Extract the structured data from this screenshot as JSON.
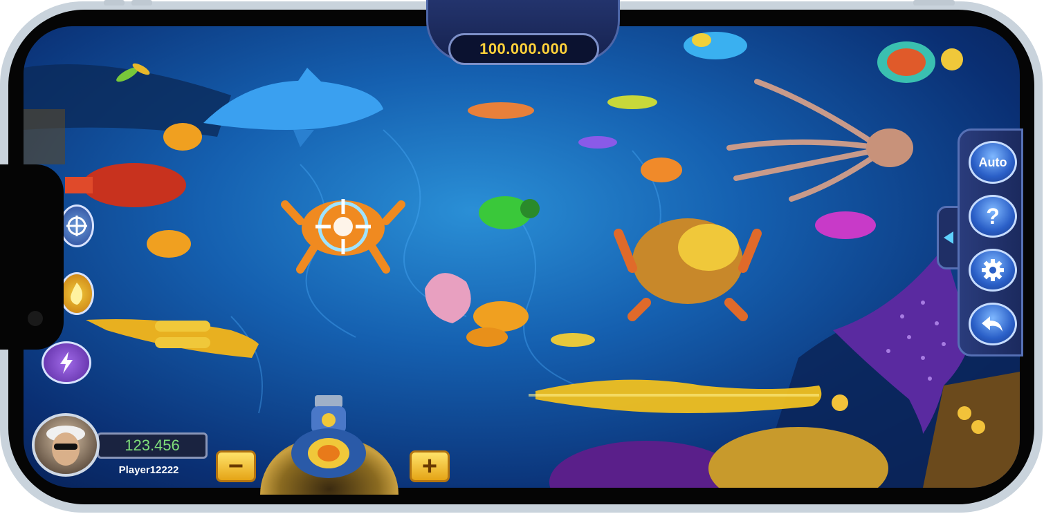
{
  "hud": {
    "jackpot": "100.000.000",
    "balance": "123.456",
    "player_name": "Player12222"
  },
  "right_menu": {
    "auto_label": "Auto",
    "help_glyph": "?",
    "settings_icon": "gear-icon",
    "back_icon": "back-arrow-icon",
    "collapse_icon": "triangle-left-icon"
  },
  "left_tools": {
    "target_icon": "crosshair-icon",
    "freeze_icon": "fire-icon",
    "lightning_icon": "lightning-icon"
  },
  "bet_controls": {
    "minus_label": "−",
    "plus_label": "+"
  },
  "colors": {
    "jackpot_text": "#ffd23a",
    "balance_text": "#7fe07a",
    "ocean": "#1560b0",
    "accent_gold": "#f2b22a"
  }
}
